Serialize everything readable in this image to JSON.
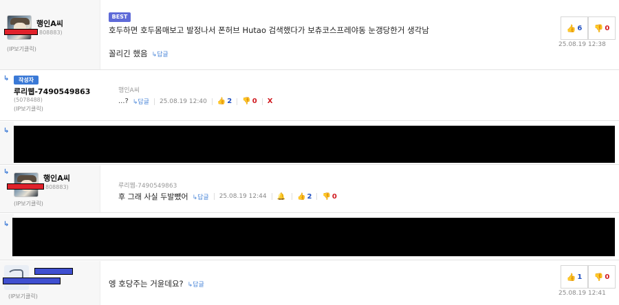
{
  "comment1": {
    "nick": "행인A씨",
    "uid": "808883)",
    "ipview": "(IP보기클릭)",
    "best": "BEST",
    "line1": "호두하면 호두몸매보고 발정나서 폰허브 Hutao 검색했다가 보츄코스프레야동 눈갱당한거 생각남",
    "line2": "꼴리긴 했음",
    "reply": "↳답글",
    "up": "6",
    "down": "0",
    "time": "25.08.19 12:38"
  },
  "comment2": {
    "badge": "작성자",
    "nick": "루리웹-7490549863",
    "uid": "(5078488)",
    "ipview": "(IP보기클릭)",
    "mention": "행인A씨",
    "text": "...?",
    "reply": "↳답글",
    "time": "25.08.19 12:40",
    "up": "2",
    "down": "0",
    "delete": "X"
  },
  "comment4": {
    "nick": "행인A씨",
    "uid": "808883)",
    "ipview": "(IP보기클릭)",
    "mention": "루리웹-7490549863",
    "text": "후 그래 사실 두발뺐어",
    "reply": "↳답글",
    "time": "25.08.19 12:44",
    "up": "2",
    "down": "0"
  },
  "comment6": {
    "ipview": "(IP보기클릭)",
    "text": "엥 호당주는 거윤데요?",
    "reply": "↳답글",
    "up": "1",
    "down": "0",
    "time": "25.08.19 12:41"
  },
  "icons": {
    "reply_arrow": "reply-arrow-icon",
    "thumb_up": "thumb-up-icon",
    "thumb_down": "thumb-down-icon",
    "alarm": "bell-icon"
  },
  "colors": {
    "up": "#1f4fc2",
    "down": "#d0181e",
    "best": "#5e6ad8",
    "writer": "#3a79d6"
  }
}
